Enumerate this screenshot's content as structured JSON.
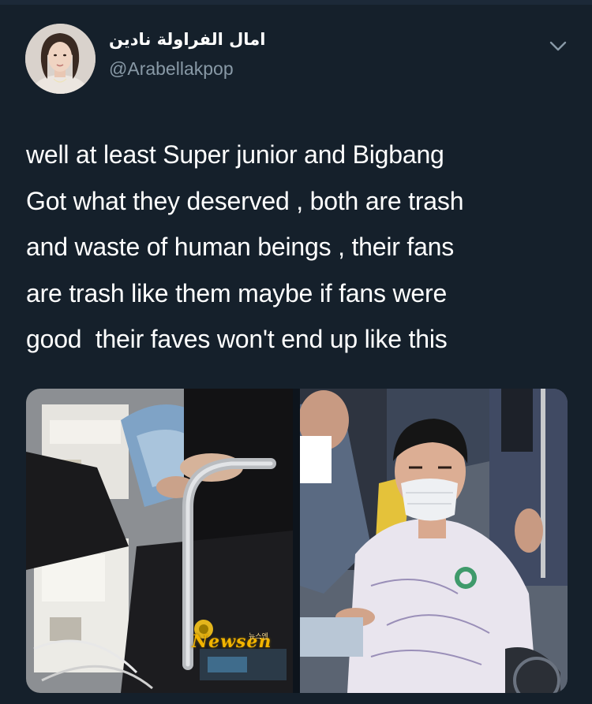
{
  "tweet": {
    "display_name": "امال الفراولة نادين",
    "handle": "@Arabellakpop",
    "text_lines": [
      "well at least Super junior and Bigbang",
      "Got what they deserved , both are trash",
      "and waste of human beings , their fans",
      "are trash like them maybe if fans were",
      "good  their faves won't end up like this"
    ],
    "menu_icon": "chevron-down-icon",
    "avatar_icon": "profile-photo"
  },
  "media": {
    "photos": [
      {
        "watermark": "Newsen",
        "watermark_small": "뉴스엔"
      },
      {}
    ]
  },
  "colors": {
    "background": "#15202b",
    "primary_text": "#ffffff",
    "secondary_text": "#8899a6"
  }
}
